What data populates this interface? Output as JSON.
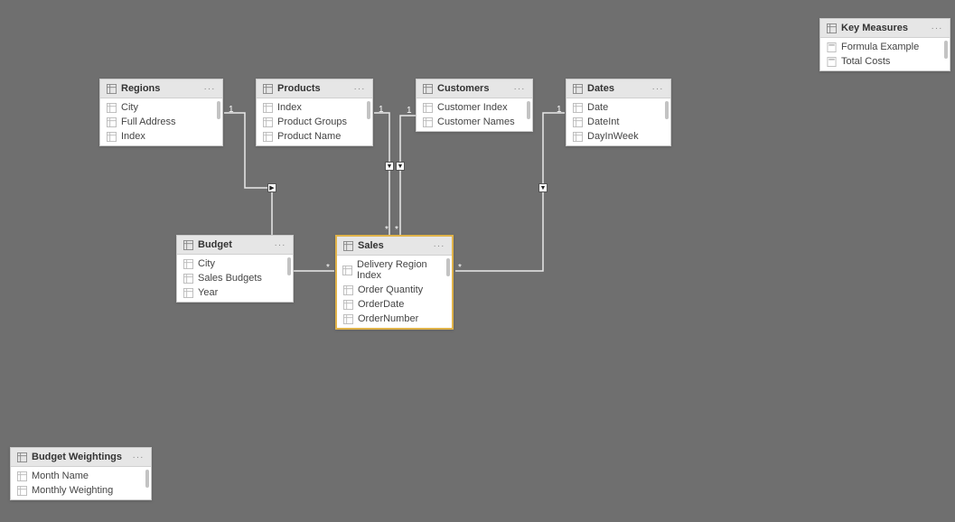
{
  "tables": {
    "regions": {
      "title": "Regions",
      "fields": [
        "City",
        "Full Address",
        "Index"
      ]
    },
    "products": {
      "title": "Products",
      "fields": [
        "Index",
        "Product Groups",
        "Product Name"
      ]
    },
    "customers": {
      "title": "Customers",
      "fields": [
        "Customer Index",
        "Customer Names"
      ]
    },
    "dates": {
      "title": "Dates",
      "fields": [
        "Date",
        "DateInt",
        "DayInWeek"
      ]
    },
    "budget": {
      "title": "Budget",
      "fields": [
        "City",
        "Sales Budgets",
        "Year"
      ]
    },
    "sales": {
      "title": "Sales",
      "fields": [
        "Delivery Region Index",
        "Order Quantity",
        "OrderDate",
        "OrderNumber"
      ]
    },
    "keymeasures": {
      "title": "Key Measures",
      "fields": [
        "Formula Example",
        "Total Costs"
      ]
    },
    "budgetweightings": {
      "title": "Budget Weightings",
      "fields": [
        "Month Name",
        "Monthly Weighting"
      ]
    }
  },
  "cardinality": {
    "one": "1",
    "many": "*"
  },
  "menu_glyph": "···"
}
